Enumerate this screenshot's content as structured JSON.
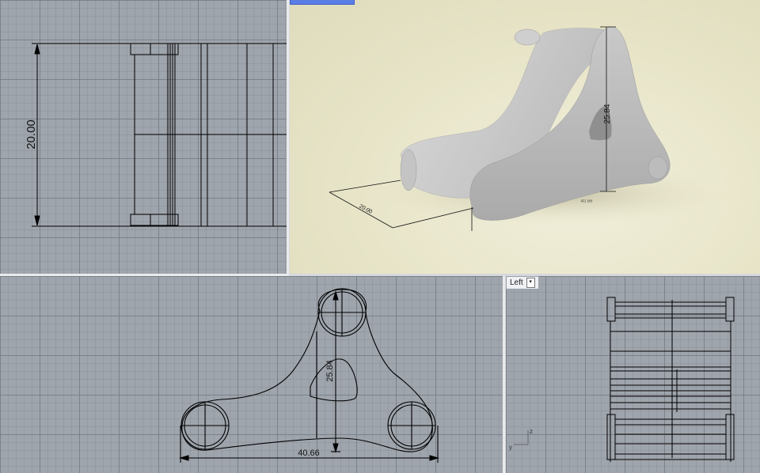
{
  "viewports": {
    "top": {
      "dimension_label": "20.00"
    },
    "perspective": {
      "tab_label": "",
      "dimension_height": "25.84",
      "dimension_depth": "20.00",
      "dimension_width": "40.66"
    },
    "front": {
      "dimension_height": "25.84",
      "dimension_width": "40.66"
    },
    "left": {
      "tab_label": "Left",
      "tab_menu_glyph": "▾",
      "axis_z": "z",
      "axis_y": "y"
    }
  },
  "colors": {
    "grid_background": "#9fa5ad",
    "perspective_background": "#e6e3c6",
    "active_tab": "#5b7de6",
    "geometry_line": "#000000"
  }
}
